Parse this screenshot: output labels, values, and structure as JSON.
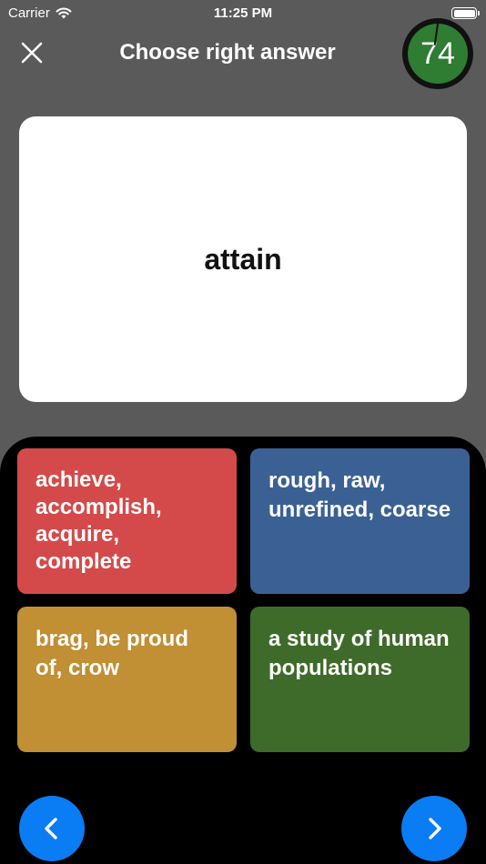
{
  "status_bar": {
    "carrier": "Carrier",
    "time": "11:25 PM"
  },
  "header": {
    "title": "Choose right answer",
    "timer": "74"
  },
  "card": {
    "word": "attain"
  },
  "answers": [
    {
      "text": "achieve, accomplish, acquire, complete",
      "color": "#d44a4a"
    },
    {
      "text": "rough, raw, unrefined, coarse",
      "color": "#3b6194"
    },
    {
      "text": "brag, be proud of, crow",
      "color": "#c18f34"
    },
    {
      "text": "a study of human populations",
      "color": "#3e6b2a"
    }
  ],
  "icons": {
    "close": "close-icon",
    "prev": "chevron-left-icon",
    "next": "chevron-right-icon",
    "wifi": "wifi-icon",
    "battery": "battery-icon"
  },
  "colors": {
    "background": "#5a5a5a",
    "panel": "#000000",
    "nav": "#0a7cf4",
    "timer": "#2e7d32"
  }
}
